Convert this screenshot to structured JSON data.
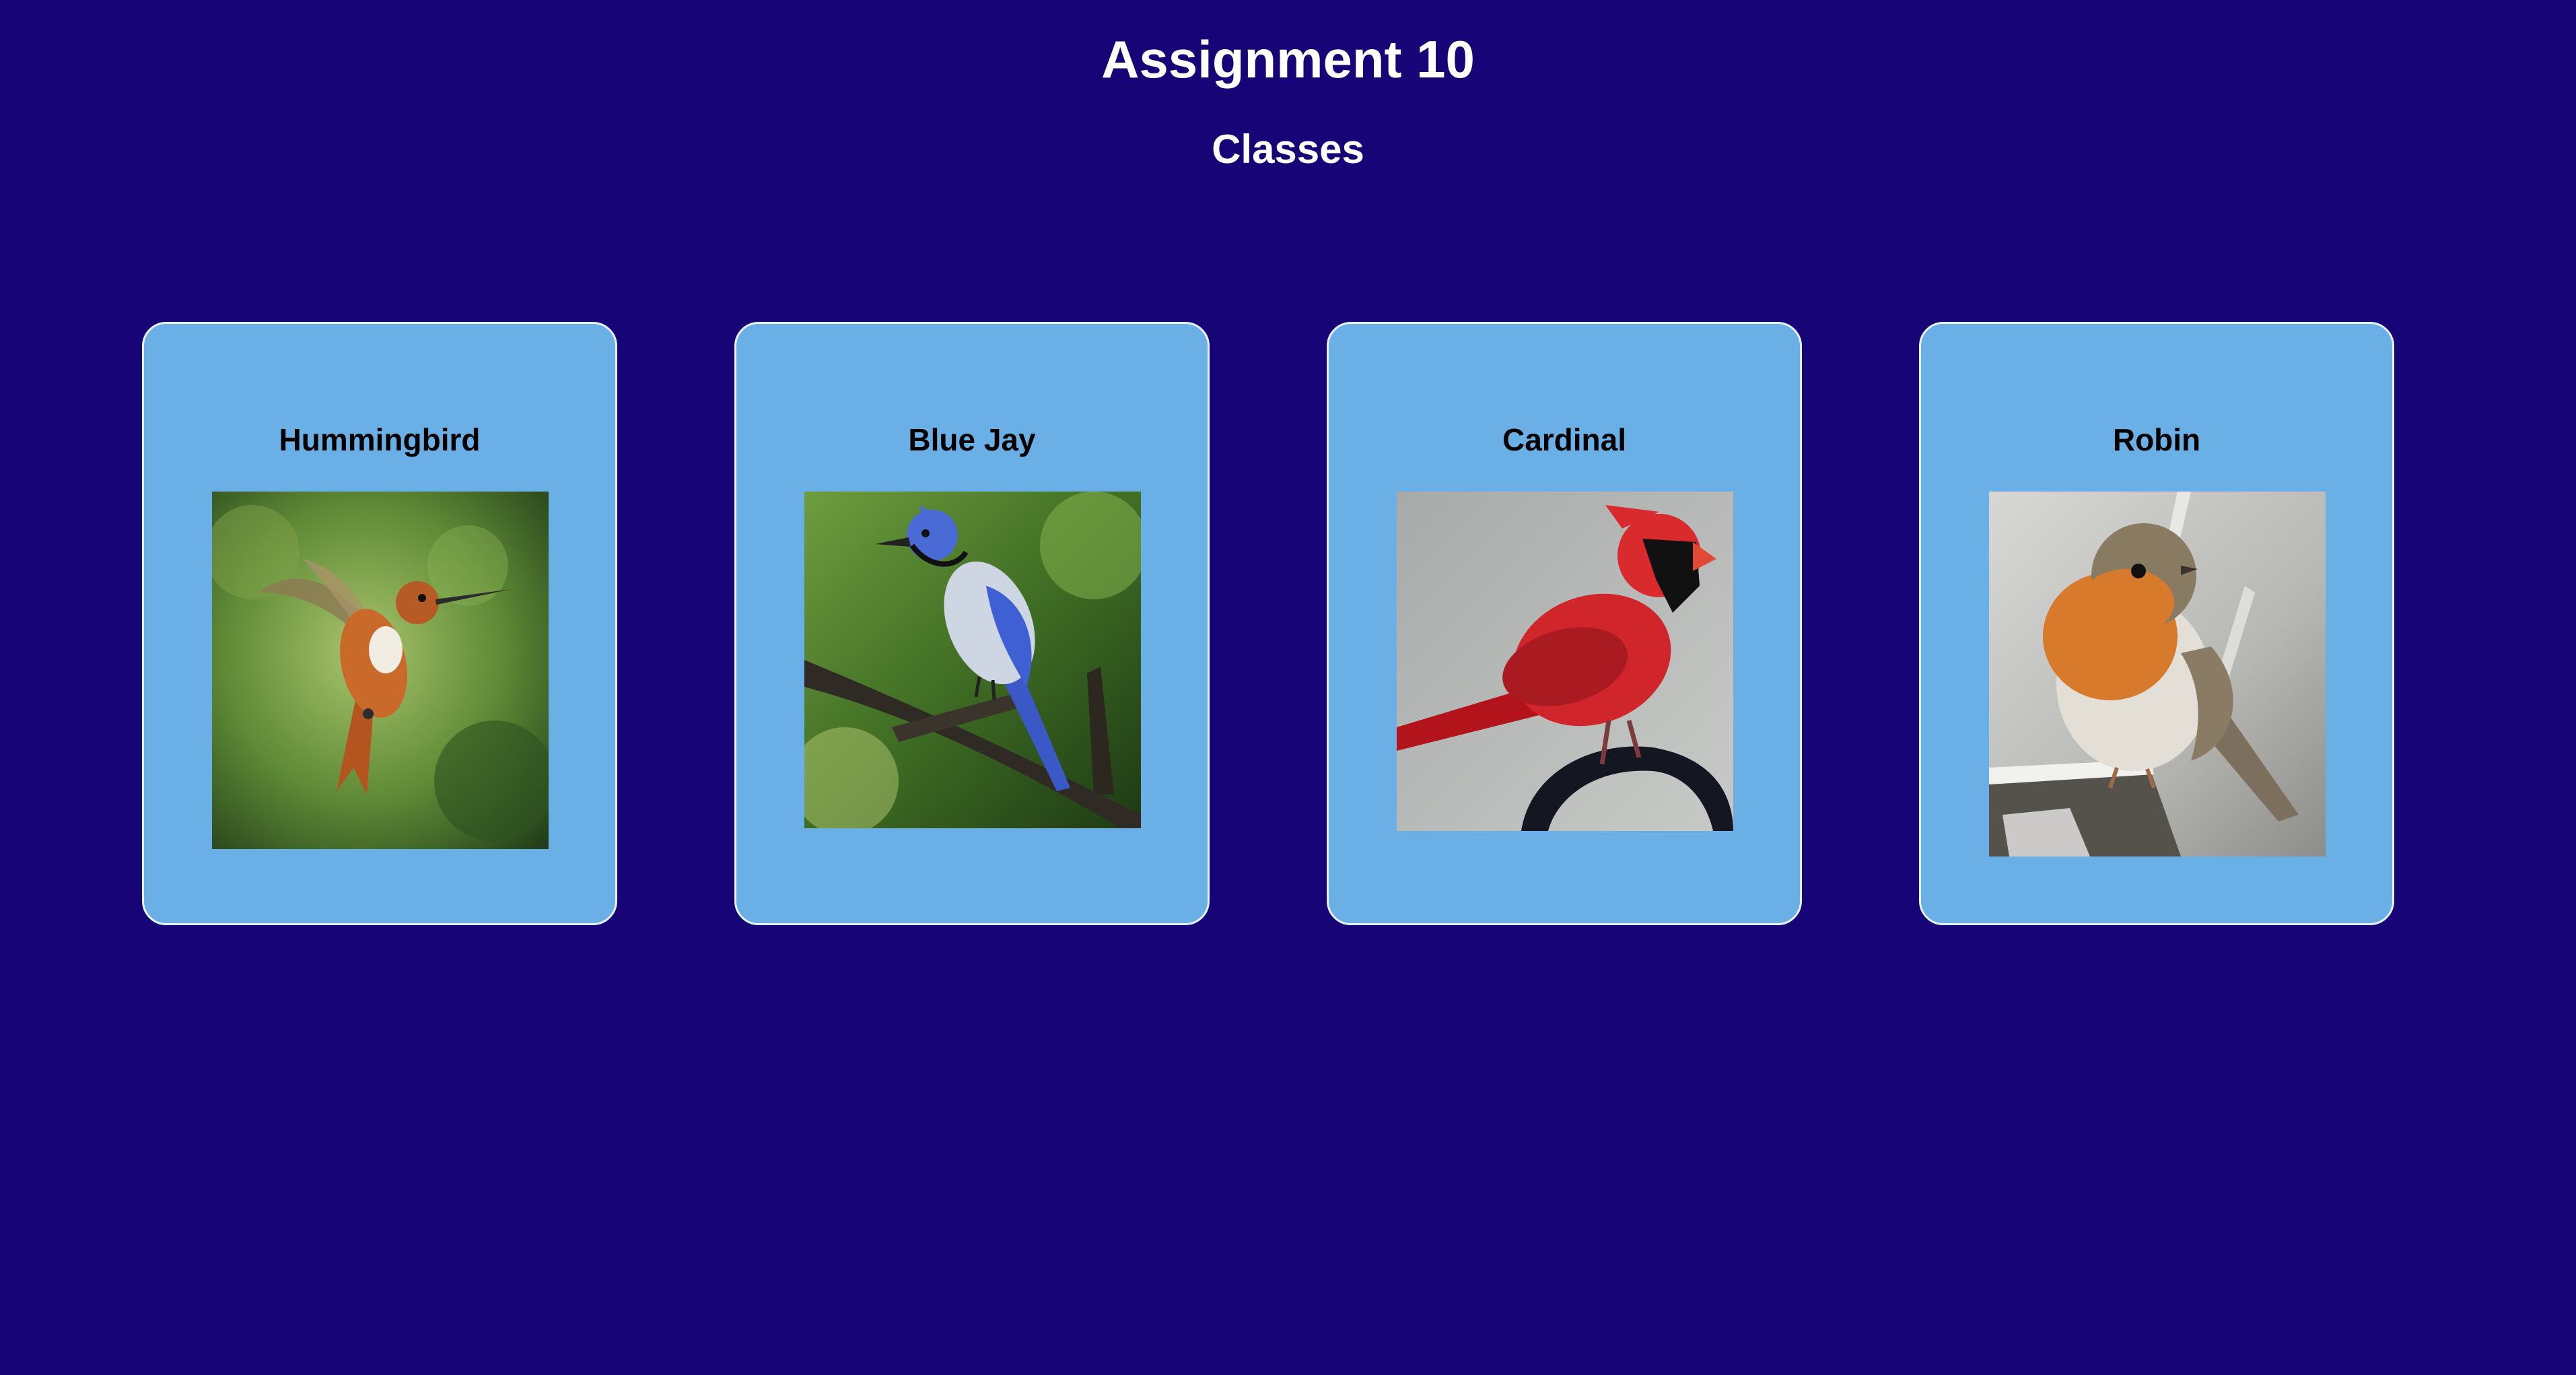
{
  "header": {
    "title": "Assignment 10",
    "subtitle": "Classes"
  },
  "cards": [
    {
      "title": "Hummingbird",
      "photo": "hummingbird-photo"
    },
    {
      "title": "Blue Jay",
      "photo": "blue-jay-photo"
    },
    {
      "title": "Cardinal",
      "photo": "cardinal-photo"
    },
    {
      "title": "Robin",
      "photo": "robin-photo"
    }
  ],
  "colors": {
    "background": "#170477",
    "card": "#6aafe6",
    "card_border": "#e8f1ff",
    "title_text": "#ffffff",
    "card_text": "#000000"
  }
}
